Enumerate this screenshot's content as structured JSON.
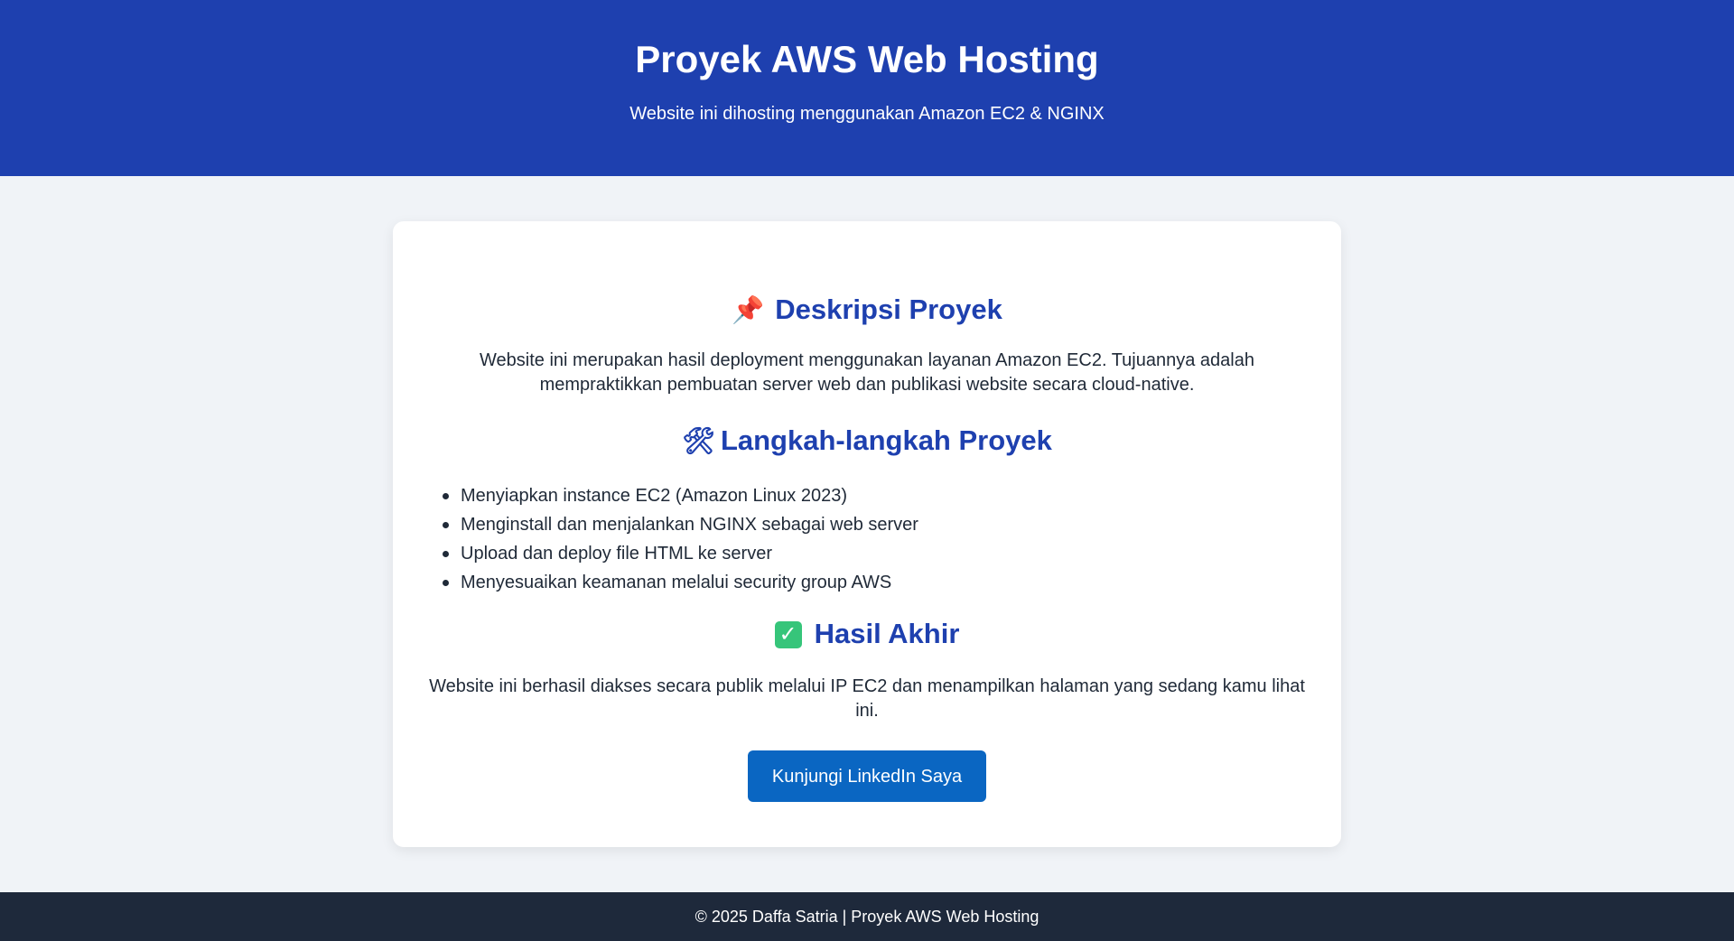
{
  "header": {
    "title": "Proyek AWS Web Hosting",
    "subtitle": "Website ini dihosting menggunakan Amazon EC2 & NGINX"
  },
  "sections": {
    "description": {
      "icon": "pushpin-icon",
      "emoji": "📌",
      "heading": "Deskripsi Proyek",
      "text": "Website ini merupakan hasil deployment menggunakan layanan Amazon EC2. Tujuannya adalah mempraktikkan pembuatan server web dan publikasi website secara cloud-native."
    },
    "steps": {
      "icon": "hammer-wrench-icon",
      "emoji": "🛠",
      "heading": "Langkah-langkah Proyek",
      "items": [
        "Menyiapkan instance EC2 (Amazon Linux 2023)",
        "Menginstall dan menjalankan NGINX sebagai web server",
        "Upload dan deploy file HTML ke server",
        "Menyesuaikan keamanan melalui security group AWS"
      ]
    },
    "result": {
      "icon": "check-mark-icon",
      "emoji": "✓",
      "heading": "Hasil Akhir",
      "text": "Website ini berhasil diakses secara publik melalui IP EC2 dan menampilkan halaman yang sedang kamu lihat ini."
    }
  },
  "cta": {
    "label": "Kunjungi LinkedIn Saya"
  },
  "footer": {
    "text": "© 2025 Daffa Satria | Proyek AWS Web Hosting"
  },
  "colors": {
    "header_bg": "#1e40af",
    "page_bg": "#f0f3f7",
    "heading_color": "#1e40af",
    "button_bg": "#0a66c2",
    "footer_bg": "#1e293b"
  }
}
